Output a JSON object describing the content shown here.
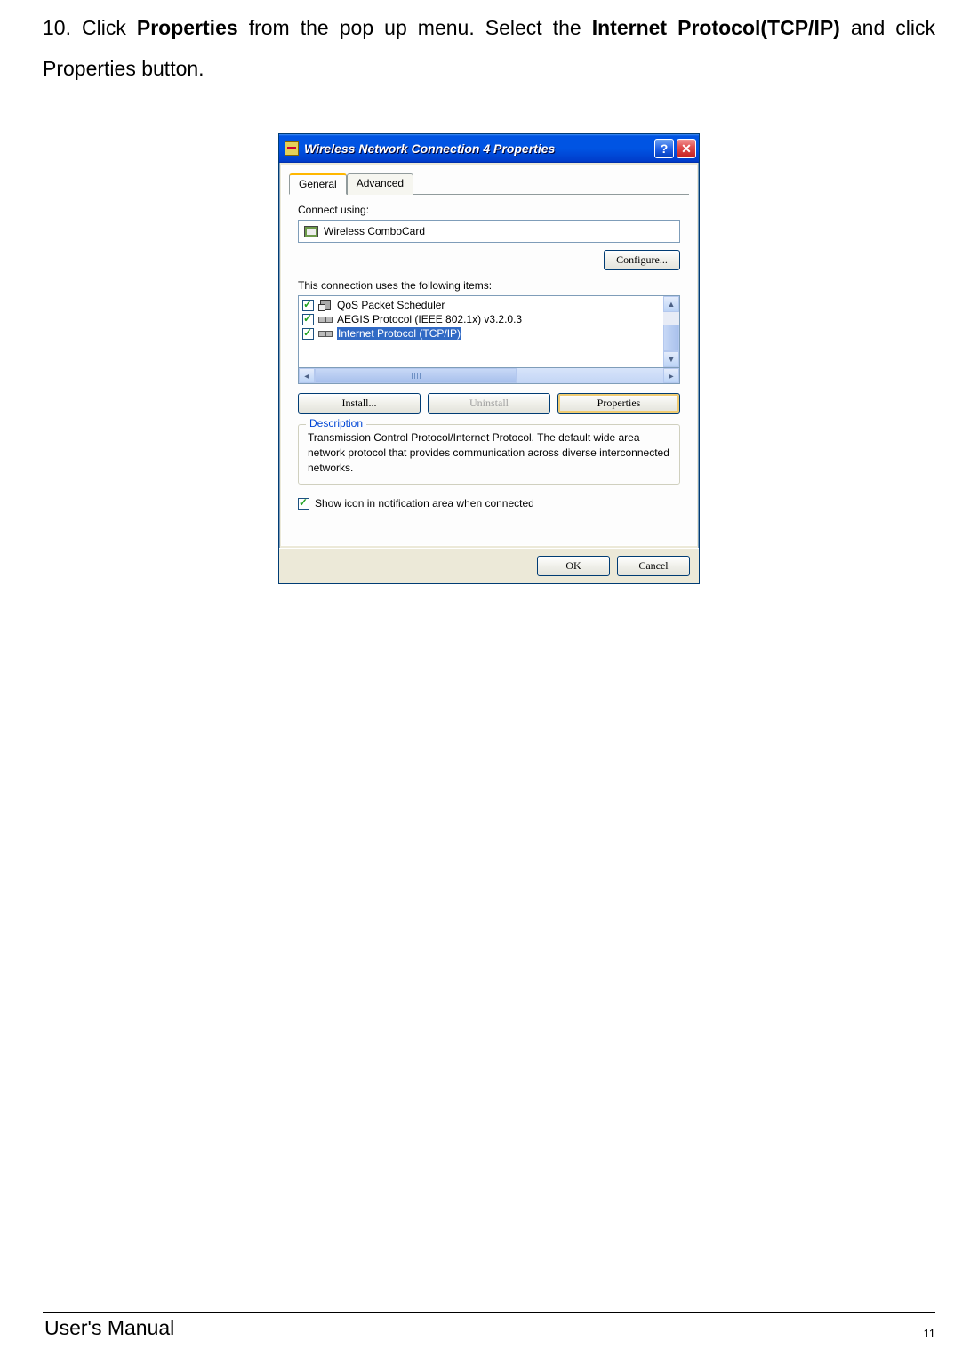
{
  "instruction": {
    "prefix": "10. Click ",
    "b1": "Properties",
    "mid": " from the pop up menu. Select the ",
    "b2": "Internet Protocol(TCP/IP)",
    "suffix": " and click Properties button."
  },
  "dialog": {
    "title": "Wireless Network Connection 4 Properties",
    "help": "?",
    "close": "✕",
    "tabs": {
      "general": "General",
      "advanced": "Advanced"
    },
    "connect_using_label": "Connect using:",
    "adapter_name": "Wireless ComboCard",
    "configure_btn": "Configure...",
    "items_label": "This connection uses the following items:",
    "items": [
      {
        "label": "QoS Packet Scheduler",
        "selected": false,
        "iconClass": "qos-icon"
      },
      {
        "label": "AEGIS Protocol (IEEE 802.1x) v3.2.0.3",
        "selected": false,
        "iconClass": "net-icon"
      },
      {
        "label": "Internet Protocol (TCP/IP)",
        "selected": true,
        "iconClass": "net-icon"
      }
    ],
    "install_btn": "Install...",
    "uninstall_btn": "Uninstall",
    "properties_btn": "Properties",
    "description_label": "Description",
    "description_text": "Transmission Control Protocol/Internet Protocol. The default wide area network protocol that provides communication across diverse interconnected networks.",
    "show_icon_label": "Show icon in notification area when connected",
    "ok_btn": "OK",
    "cancel_btn": "Cancel"
  },
  "footer": {
    "left": "User's Manual",
    "right": "11"
  }
}
